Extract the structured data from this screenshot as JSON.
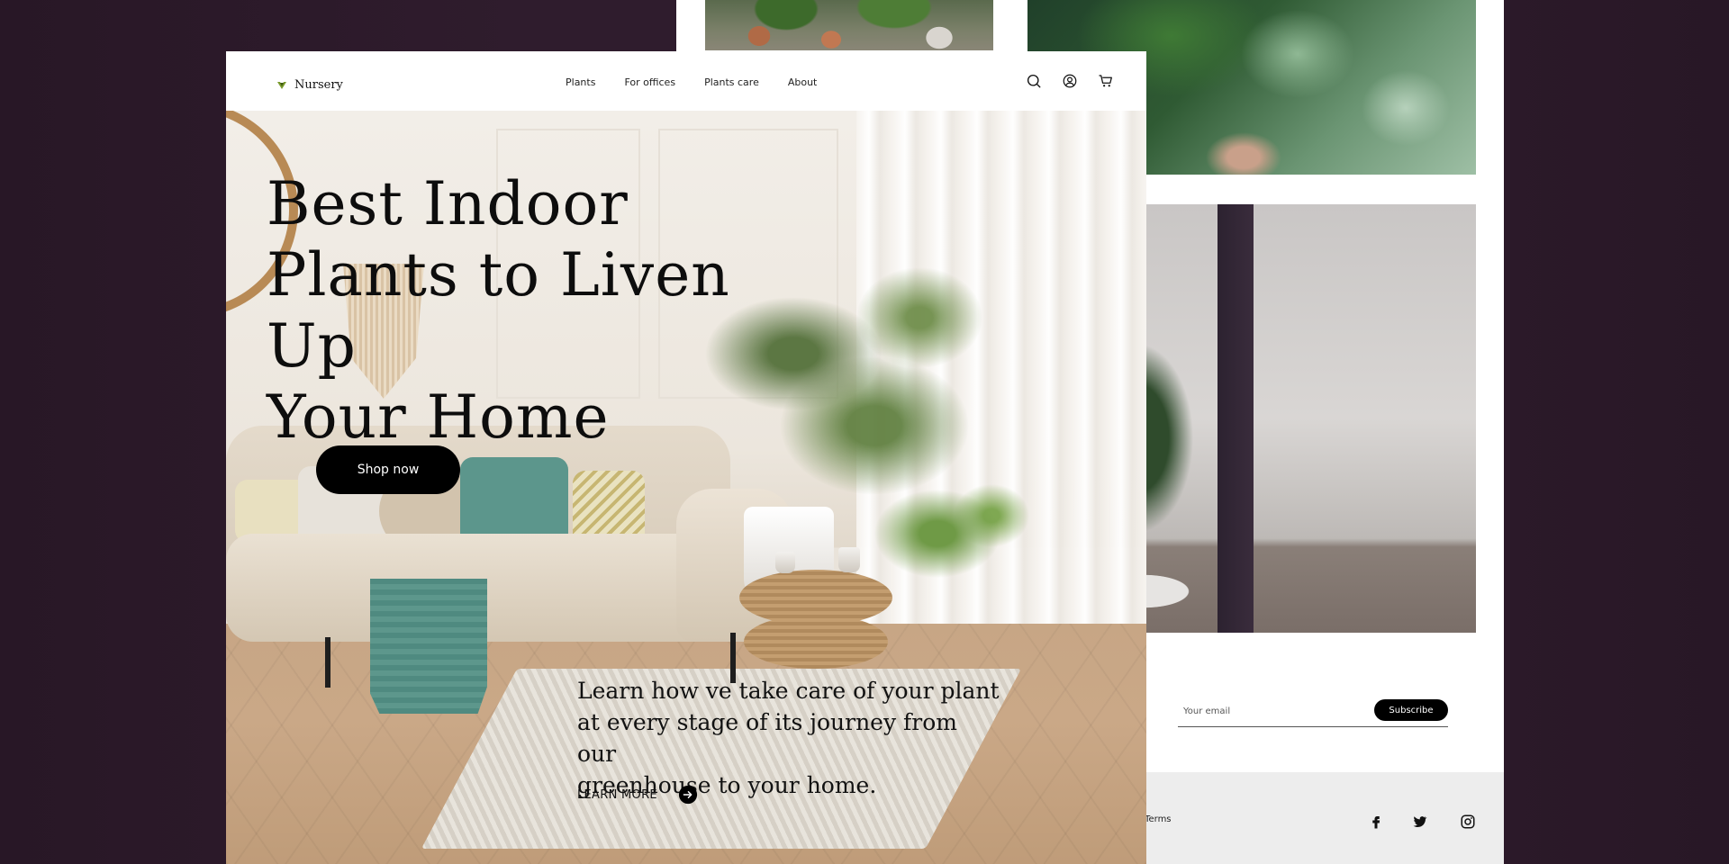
{
  "header": {
    "logo_text": "Nursery",
    "nav": [
      "Plants",
      "For offices",
      "Plants care",
      "About"
    ],
    "icons": [
      "search-icon",
      "account-icon",
      "cart-icon"
    ]
  },
  "hero": {
    "title_lines": [
      "Best Indoor",
      "Plants to Liven Up",
      "Your Home"
    ],
    "shop_button": "Shop now",
    "learn_lines": [
      "Learn how ve take care of your plant",
      "at every stage of its journey from our",
      "greenhouse to your home."
    ],
    "learn_more": "LEARN MORE"
  },
  "back_page": {
    "subscribe": {
      "email_placeholder": "Your email",
      "button_label": "Subscribe"
    },
    "footer": {
      "link_text": "y & Terms",
      "social": [
        "facebook-icon",
        "twitter-icon",
        "instagram-icon"
      ]
    }
  },
  "colors": {
    "background": "#2f1c2d",
    "button": "#000000",
    "button_text": "#ffffff",
    "logo_accent": "#7a9a2e"
  }
}
